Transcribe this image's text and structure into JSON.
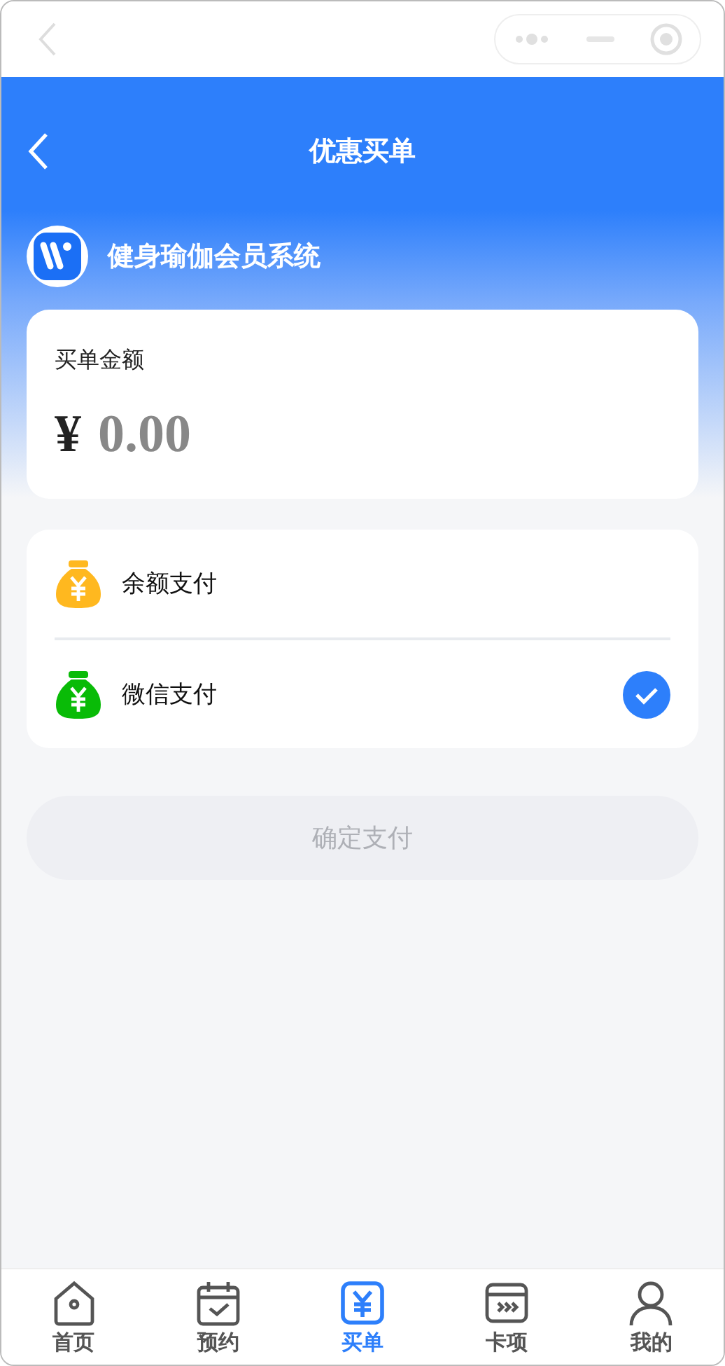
{
  "header": {
    "title": "优惠买单"
  },
  "brand": {
    "name": "健身瑜伽会员系统"
  },
  "amount_card": {
    "label": "买单金额",
    "currency": "¥",
    "amount": "0.00"
  },
  "payment_methods": [
    {
      "label": "余额支付",
      "color": "#ffb81f",
      "selected": false
    },
    {
      "label": "微信支付",
      "color": "#09bb07",
      "selected": true
    }
  ],
  "confirm_button": {
    "label": "确定支付",
    "disabled": true
  },
  "tab_bar": [
    {
      "kind": "home",
      "label": "首页",
      "selected": false
    },
    {
      "kind": "booking",
      "label": "预约",
      "selected": false
    },
    {
      "kind": "pay",
      "label": "买单",
      "selected": true
    },
    {
      "kind": "cards",
      "label": "卡项",
      "selected": false
    },
    {
      "kind": "profile",
      "label": "我的",
      "selected": false
    }
  ]
}
